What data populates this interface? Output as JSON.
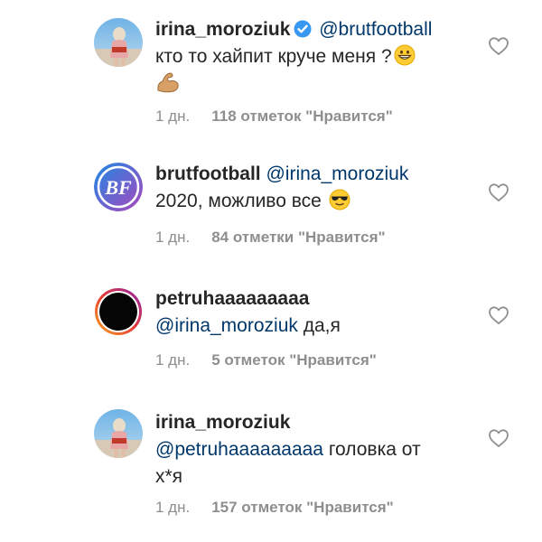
{
  "comments": [
    {
      "username": "irina_moroziuk",
      "verified": true,
      "mention": "@brutfootball",
      "text": "кто то хайпит круче меня ?",
      "emoji_after_text": "grinning-face-icon",
      "extra_emoji": "flexed-biceps-icon",
      "time": "1 дн.",
      "likes": "118 отметок \"Нравится\""
    },
    {
      "username": "brutfootball",
      "mention": "@irina_moroziuk",
      "text": "2020, можливо все",
      "emoji_after_text": "sunglasses-face-icon",
      "avatar_text": "BF",
      "time": "1 дн.",
      "likes": "84 отметки \"Нравится\""
    },
    {
      "username": "petruhaaaaaaaaa",
      "mention": "@irina_moroziuk",
      "text": "да,я",
      "time": "1 дн.",
      "likes": "5 отметок \"Нравится\""
    },
    {
      "username": "irina_moroziuk",
      "mention": "@petruhaaaaaaaaa",
      "text": "головка от",
      "text_line2": "х*я",
      "time": "1 дн.",
      "likes": "157 отметок \"Нравится\""
    }
  ],
  "colors": {
    "mention": "#00376b",
    "meta": "#8e8e8e",
    "verified": "#3897f0",
    "brut_gradient_start": "#1e88e5",
    "brut_gradient_end": "#ab47bc"
  }
}
